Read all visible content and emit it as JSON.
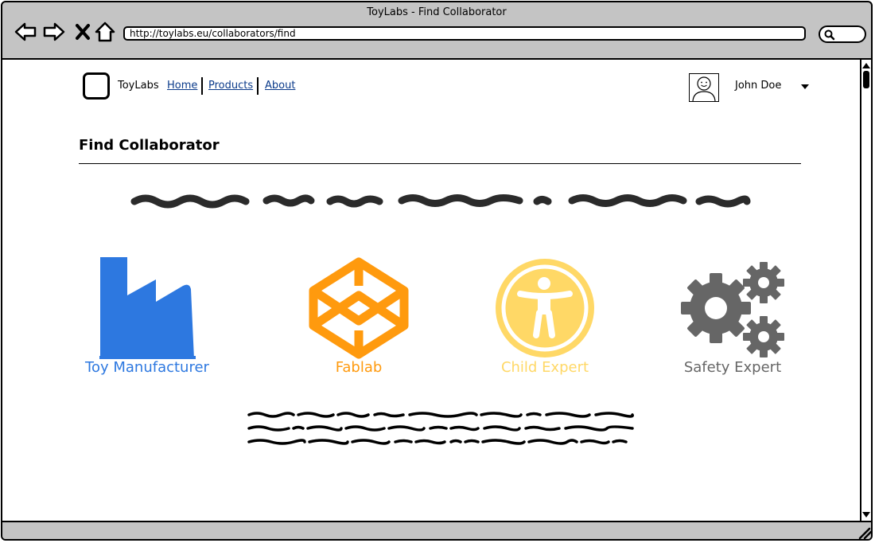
{
  "window": {
    "title": "ToyLabs - Find Collaborator"
  },
  "browser": {
    "url": "http://toylabs.eu/collaborators/find"
  },
  "header": {
    "brand": "ToyLabs",
    "nav": [
      {
        "label": "Home"
      },
      {
        "label": "Products"
      },
      {
        "label": "About"
      }
    ],
    "user_name": "John Doe"
  },
  "page": {
    "title": "Find Collaborator"
  },
  "categories": [
    {
      "label": "Toy Manufacturer",
      "icon": "factory-icon",
      "color": "#2d78e0"
    },
    {
      "label": "Fablab",
      "icon": "codepen-cube-icon",
      "color": "#ff9a0e"
    },
    {
      "label": "Child Expert",
      "icon": "accessibility-icon",
      "color": "#ffd866"
    },
    {
      "label": "Safety Expert",
      "icon": "gears-icon",
      "color": "#666666"
    }
  ]
}
